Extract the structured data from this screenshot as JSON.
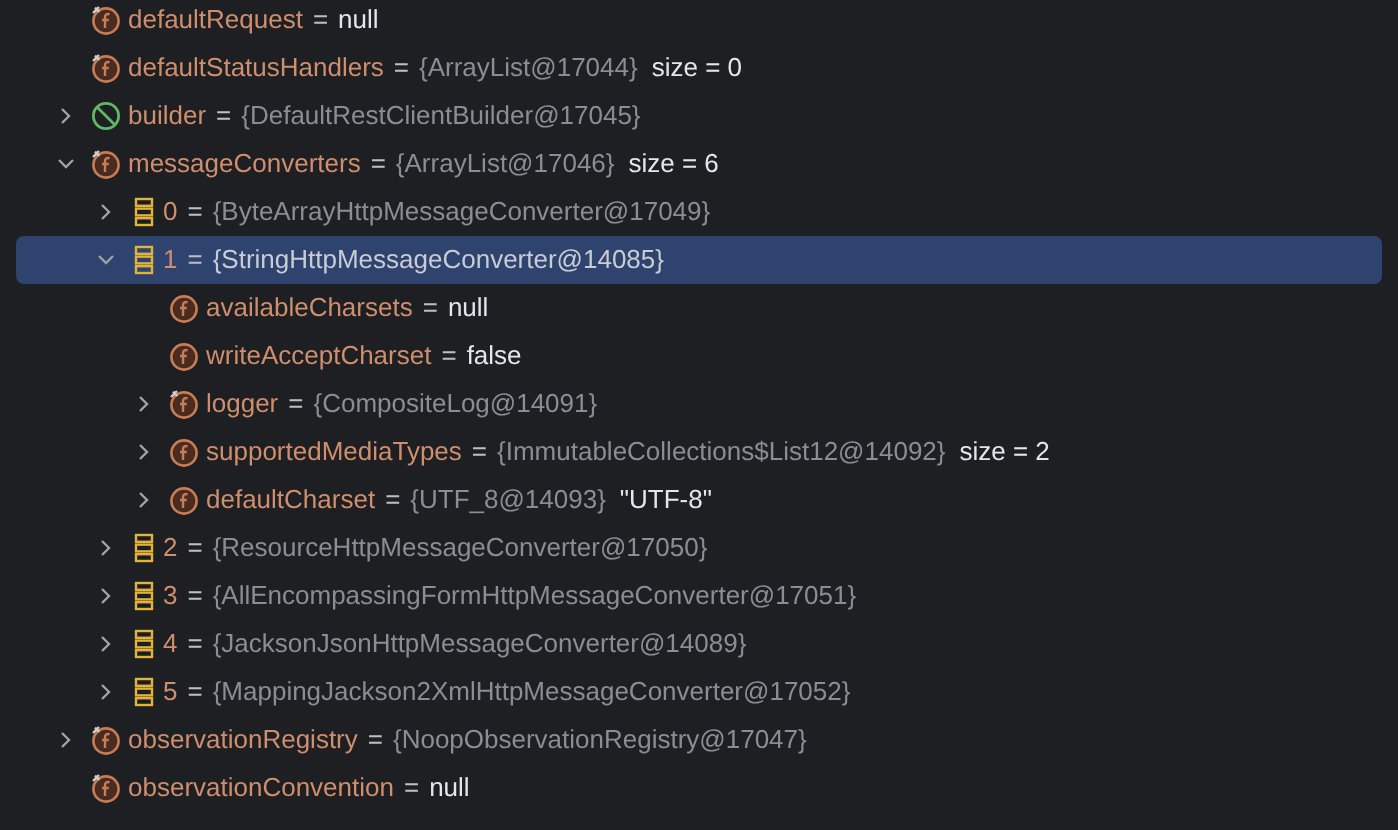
{
  "tree": [
    {
      "kind": "final-field",
      "name": "defaultRequest",
      "equals": "=",
      "value": "null"
    },
    {
      "kind": "final-field",
      "name": "defaultStatusHandlers",
      "equals": "=",
      "reference": "{ArrayList@17044}",
      "extra": "size = 0"
    },
    {
      "kind": "no-entry",
      "name": "builder",
      "equals": "=",
      "reference": "{DefaultRestClientBuilder@17045}",
      "expanded": false
    },
    {
      "kind": "final-field",
      "name": "messageConverters",
      "equals": "=",
      "reference": "{ArrayList@17046}",
      "extra": "size = 6",
      "expanded": true,
      "children": [
        {
          "kind": "array-item",
          "name": "0",
          "equals": "=",
          "reference": "{ByteArrayHttpMessageConverter@17049}",
          "expanded": false
        },
        {
          "kind": "array-item",
          "name": "1",
          "equals": "=",
          "reference": "{StringHttpMessageConverter@14085}",
          "expanded": true,
          "selected": true,
          "children": [
            {
              "kind": "field",
              "name": "availableCharsets",
              "equals": "=",
              "value": "null"
            },
            {
              "kind": "field",
              "name": "writeAcceptCharset",
              "equals": "=",
              "value": "false"
            },
            {
              "kind": "final-field",
              "name": "logger",
              "equals": "=",
              "reference": "{CompositeLog@14091}",
              "expanded": false
            },
            {
              "kind": "field",
              "name": "supportedMediaTypes",
              "equals": "=",
              "reference": "{ImmutableCollections$List12@14092}",
              "extra": "size = 2",
              "expanded": false
            },
            {
              "kind": "field",
              "name": "defaultCharset",
              "equals": "=",
              "reference": "{UTF_8@14093}",
              "extra": "\"UTF-8\"",
              "expanded": false
            }
          ]
        },
        {
          "kind": "array-item",
          "name": "2",
          "equals": "=",
          "reference": "{ResourceHttpMessageConverter@17050}",
          "expanded": false
        },
        {
          "kind": "array-item",
          "name": "3",
          "equals": "=",
          "reference": "{AllEncompassingFormHttpMessageConverter@17051}",
          "expanded": false
        },
        {
          "kind": "array-item",
          "name": "4",
          "equals": "=",
          "reference": "{JacksonJsonHttpMessageConverter@14089}",
          "expanded": false
        },
        {
          "kind": "array-item",
          "name": "5",
          "equals": "=",
          "reference": "{MappingJackson2XmlHttpMessageConverter@17052}",
          "expanded": false
        }
      ]
    },
    {
      "kind": "final-field",
      "name": "observationRegistry",
      "equals": "=",
      "reference": "{NoopObservationRegistry@17047}",
      "expanded": false
    },
    {
      "kind": "final-field",
      "name": "observationConvention",
      "equals": "=",
      "value": "null"
    }
  ]
}
